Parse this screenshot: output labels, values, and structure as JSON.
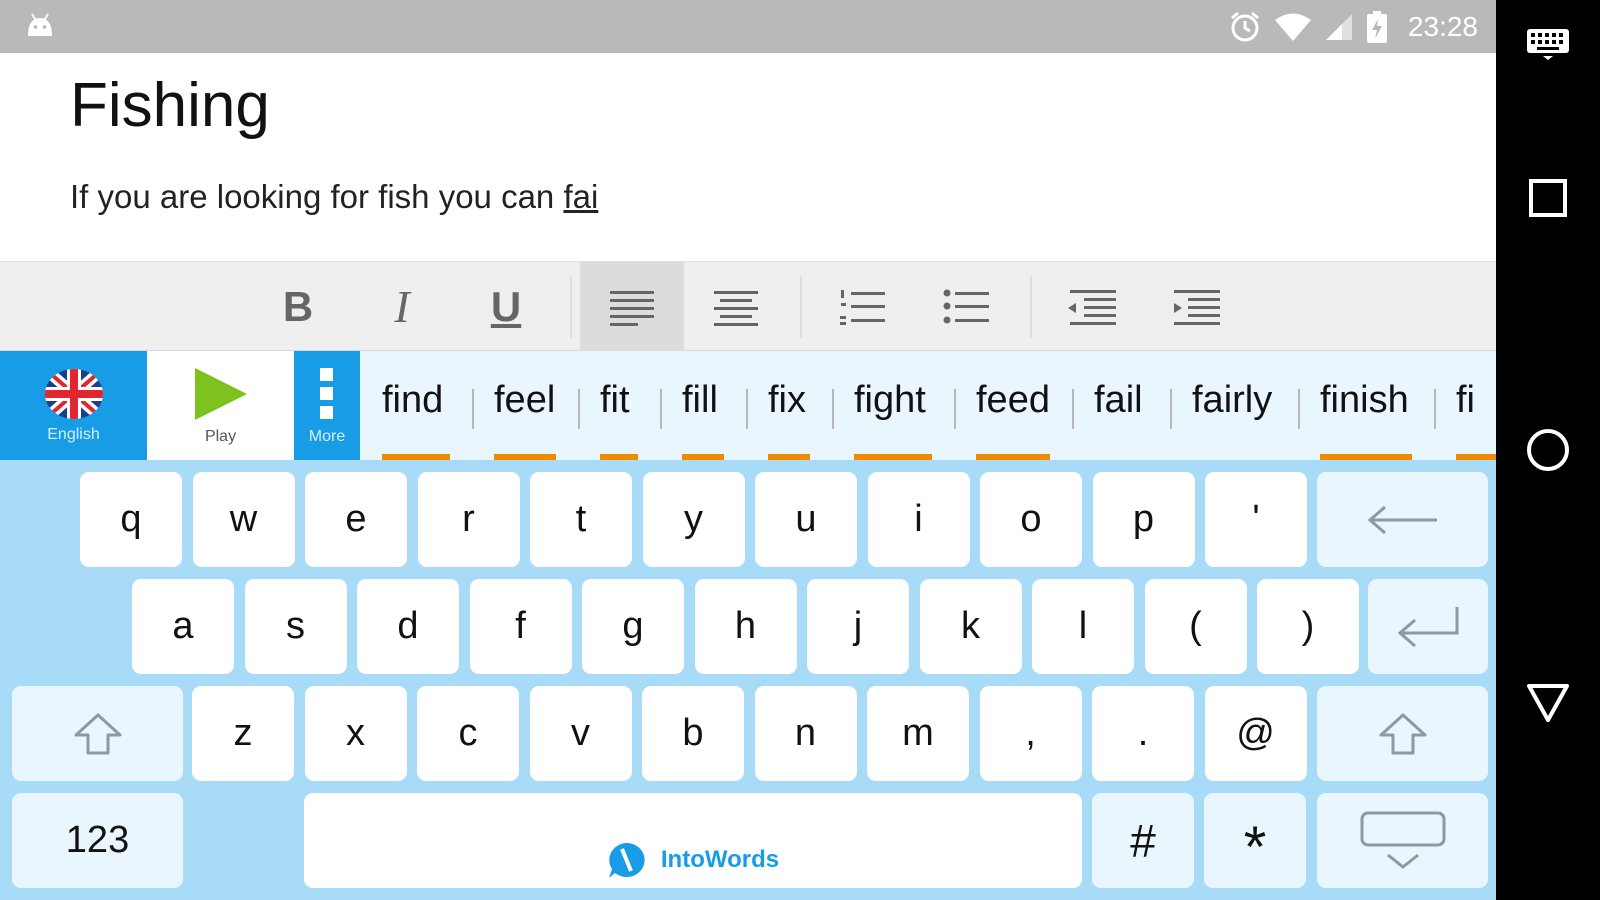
{
  "status_bar": {
    "time": "23:28",
    "icons": [
      "android-icon",
      "alarm-icon",
      "wifi-icon",
      "signal-icon",
      "battery-icon"
    ]
  },
  "document": {
    "title": "Fishing",
    "text_prefix": "If you are looking for fish you can ",
    "current_word": "fai"
  },
  "format_toolbar": {
    "bold_label": "B",
    "italic_label": "I",
    "underline_label": "U",
    "active_button": "align-left"
  },
  "suggestion_bar": {
    "language_label": "English",
    "play_label": "Play",
    "more_label": "More",
    "words": [
      {
        "text": "find",
        "marked": true
      },
      {
        "text": "feel",
        "marked": true
      },
      {
        "text": "fit",
        "marked": true
      },
      {
        "text": "fill",
        "marked": true
      },
      {
        "text": "fix",
        "marked": true
      },
      {
        "text": "fight",
        "marked": true
      },
      {
        "text": "feed",
        "marked": true
      },
      {
        "text": "fail",
        "marked": false
      },
      {
        "text": "fairly",
        "marked": false
      },
      {
        "text": "finish",
        "marked": true
      },
      {
        "text": "fi",
        "marked": true
      }
    ]
  },
  "keyboard": {
    "rows": [
      [
        "q",
        "w",
        "e",
        "r",
        "t",
        "y",
        "u",
        "i",
        "o",
        "p",
        "'"
      ],
      [
        "a",
        "s",
        "d",
        "f",
        "g",
        "h",
        "j",
        "k",
        "l",
        "(",
        ")"
      ],
      [
        "z",
        "x",
        "c",
        "v",
        "b",
        "n",
        "m",
        ",",
        ".",
        "@"
      ]
    ],
    "numbers_label": "123",
    "space_brand": "IntoWords",
    "hash_label": "#",
    "star_label": "*"
  },
  "colors": {
    "accent_blue": "#199ce6",
    "keyboard_bg": "#a7dbf7",
    "suggestion_underline": "#f28a00",
    "play_green": "#7dc21e"
  }
}
